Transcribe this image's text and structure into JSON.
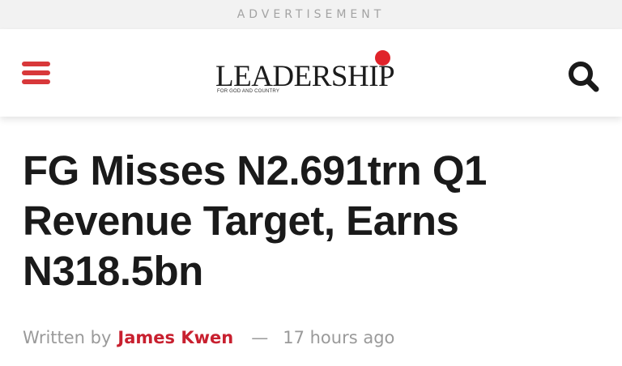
{
  "advertisement": {
    "label": "ADVERTISEMENT"
  },
  "header": {
    "menu_icon": "hamburger-menu-icon",
    "logo": {
      "name": "LEADERSHIP",
      "tagline": "FOR GOD AND COUNTRY",
      "dot_color": "#e0232a"
    },
    "search_icon": "search-icon",
    "accent_color": "#d8383a"
  },
  "article": {
    "title": "FG Misses N2.691trn Q1 Revenue Target, Earns N318.5bn",
    "byline": {
      "prefix": "Written by",
      "author": "James Kwen",
      "separator": "—",
      "time": "17 hours ago",
      "author_color": "#c8202f"
    }
  }
}
